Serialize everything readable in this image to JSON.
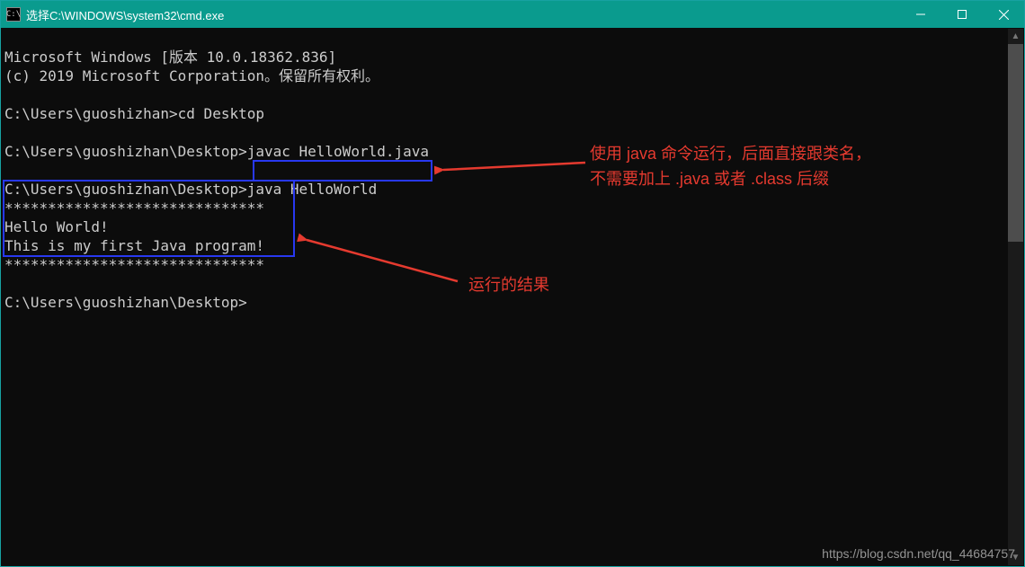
{
  "titlebar": {
    "icon_text": "C:\\",
    "title": "选择C:\\WINDOWS\\system32\\cmd.exe"
  },
  "terminal": {
    "line1": "Microsoft Windows [版本 10.0.18362.836]",
    "line2": "(c) 2019 Microsoft Corporation。保留所有权利。",
    "blank1": "",
    "prompt1": "C:\\Users\\guoshizhan>cd Desktop",
    "blank2": "",
    "prompt2": "C:\\Users\\guoshizhan\\Desktop>javac HelloWorld.java",
    "blank3": "",
    "prompt3": "C:\\Users\\guoshizhan\\Desktop>java HelloWorld",
    "out1": "******************************",
    "out2": "Hello World!",
    "out3": "This is my first Java program!",
    "out4": "******************************",
    "blank4": "",
    "prompt4": "C:\\Users\\guoshizhan\\Desktop>"
  },
  "annotations": {
    "note1_line1": "使用 java 命令运行，后面直接跟类名，",
    "note1_line2": "不需要加上 .java 或者 .class 后缀",
    "note2": "运行的结果"
  },
  "watermark": "https://blog.csdn.net/qq_44684757"
}
